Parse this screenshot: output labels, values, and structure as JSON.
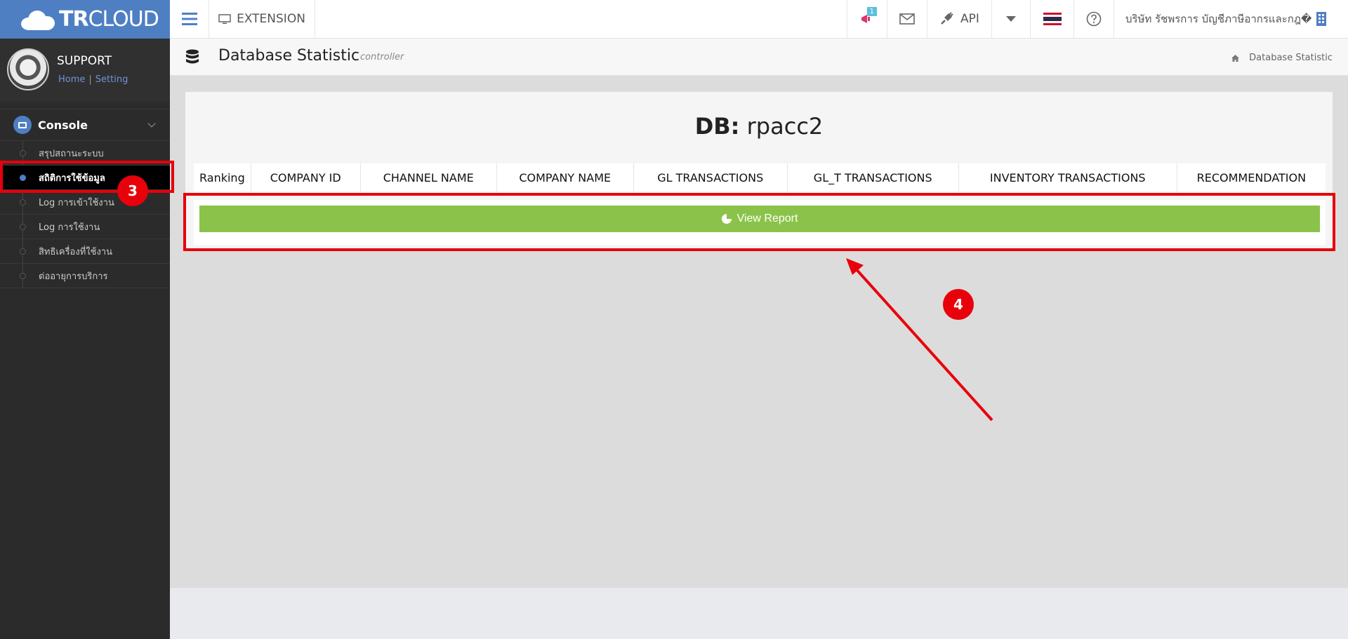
{
  "brand": {
    "name_bold": "TR",
    "name_light": "CLOUD"
  },
  "topbar": {
    "extension_label": "EXTENSION",
    "notification_count": "1",
    "api_label": "API",
    "company_name": "บริษัท รัชพรการ บัญชีภาษีอากรและกฎ�"
  },
  "sidebar": {
    "profile": {
      "name": "SUPPORT",
      "home_link": "Home",
      "link_sep": "|",
      "setting_link": "Setting"
    },
    "console_label": "Console",
    "items": [
      {
        "label": "สรุปสถานะระบบ"
      },
      {
        "label": "สถิติการใช้ข้อมูล"
      },
      {
        "label": "Log การเข้าใช้งาน"
      },
      {
        "label": "Log การใช้งาน"
      },
      {
        "label": "สิทธิเครื่องที่ใช้งาน"
      },
      {
        "label": "ต่ออายุการบริการ"
      }
    ]
  },
  "page": {
    "title": "Database Statistic",
    "subtitle": "controller",
    "breadcrumb": "Database Statistic"
  },
  "db": {
    "prefix": "DB:",
    "name": "rpacc2"
  },
  "table": {
    "columns": [
      "Ranking",
      "COMPANY ID",
      "CHANNEL NAME",
      "COMPANY NAME",
      "GL TRANSACTIONS",
      "GL_T TRANSACTIONS",
      "INVENTORY TRANSACTIONS",
      "RECOMMENDATION"
    ]
  },
  "view_report_label": "View Report",
  "annotations": {
    "step3": "3",
    "step4": "4",
    "color": "#e8000b"
  },
  "colors": {
    "brand": "#4f7fc3",
    "accent_green": "#8bc34a",
    "sidebar_bg": "#2b2b2b"
  }
}
